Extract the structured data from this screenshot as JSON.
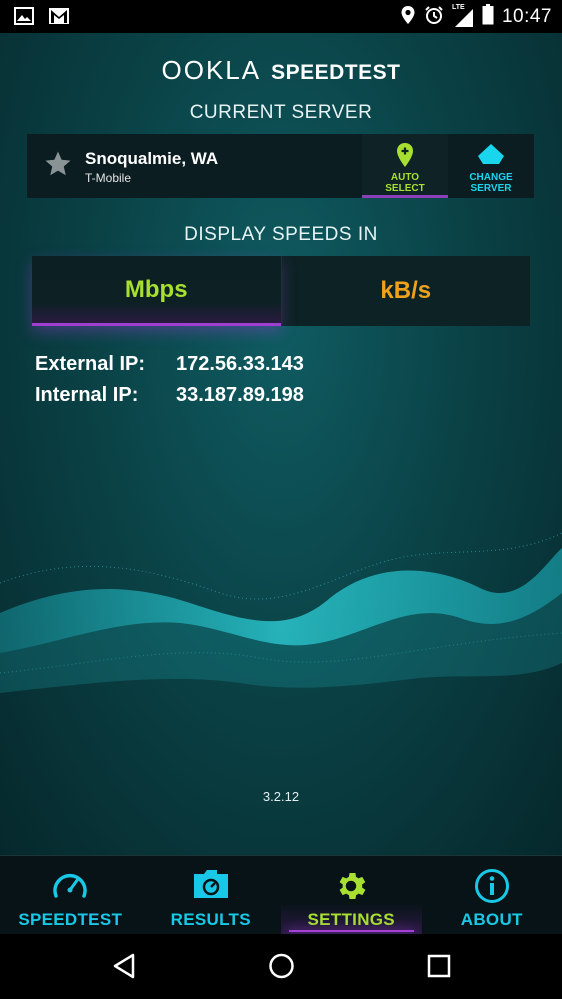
{
  "status_bar": {
    "time": "10:47",
    "network_label": "LTE",
    "left_icons": [
      "gallery-icon",
      "gmail-icon"
    ],
    "right_icons": [
      "location-icon",
      "alarm-icon",
      "signal-icon",
      "battery-icon"
    ]
  },
  "app": {
    "logo_ookla": "OOKLA",
    "logo_speedtest": "SPEEDTEST"
  },
  "server": {
    "section_title": "CURRENT SERVER",
    "city": "Snoqualmie, WA",
    "isp": "T-Mobile",
    "auto_select_label": "AUTO\nSELECT",
    "change_server_label": "CHANGE\nSERVER"
  },
  "units": {
    "section_title": "DISPLAY SPEEDS IN",
    "options": [
      "Mbps",
      "kB/s"
    ],
    "selected": "Mbps"
  },
  "network_info": {
    "external_ip_label": "External IP:",
    "external_ip": "172.56.33.143",
    "internal_ip_label": "Internal IP:",
    "internal_ip": "33.187.89.198"
  },
  "version": "3.2.12",
  "tabs": [
    {
      "label": "SPEEDTEST",
      "icon": "speedometer-icon"
    },
    {
      "label": "RESULTS",
      "icon": "results-folder-icon"
    },
    {
      "label": "SETTINGS",
      "icon": "gear-icon",
      "active": true
    },
    {
      "label": "ABOUT",
      "icon": "info-icon"
    }
  ],
  "colors": {
    "accent_green": "#a7e030",
    "accent_cyan": "#19c8e6",
    "accent_orange": "#f0a11c",
    "accent_purple": "#a63fd6",
    "background_teal": "#0a4347"
  }
}
